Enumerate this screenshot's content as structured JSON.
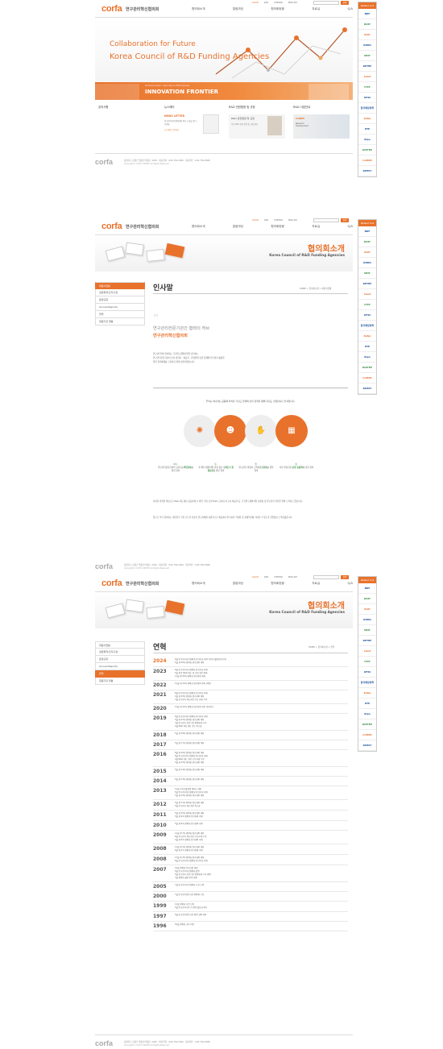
{
  "header": {
    "logo": "corfa",
    "title": "연구관리혁신협의회",
    "nav": [
      "협의회소개",
      "알림마당",
      "협의회현황",
      "자료실",
      "Q/A"
    ],
    "util": [
      "LOGIN",
      "JOIN",
      "SITEMAP",
      "ENGLISH"
    ],
    "search_btn": "검색"
  },
  "sidebar": {
    "title": "Related Link",
    "items": [
      "NRF",
      "KOIT",
      "KIAT",
      "KHIDI",
      "KEIT",
      "KETEP",
      "Ciast",
      "ITTP",
      "KFRI",
      "한국해양과학",
      "Kofpi",
      "IITP",
      "Kipo",
      "KISTEP",
      "CoMPA",
      "KIMST",
      "KISTEP"
    ]
  },
  "home": {
    "hero_en1": "Collaboration for Future",
    "hero_en2": "Korea Council of R&D Funding Agencies",
    "innovation_small": "Professionalism / Specialty & Effectiveness",
    "innovation": "INNOVATION FRONTIER",
    "cols": [
      "공지사항",
      "뉴스레터",
      "R&D 관련법령 및 규정",
      "R&D 사업안내"
    ],
    "newsletter_title": "NEWS LETTER",
    "newsletter_text": "연구관리혁신협의회의 최신 소식을 만나보세요",
    "newsletter_more": "뉴스레터 구독하기",
    "regulation_title": "R&D 관련법령 및 규정",
    "regulation_text": "각종 R&D 관련 법령 및 규정 안내",
    "corfa_title": "CORFA",
    "corfa_sub": "Research Development"
  },
  "footer": {
    "logo": "corfa",
    "address": "충청북도 음성군 맹동면 태정로 1030 · 대표전화 : 043-750-2300 · 대표팩스 : 043-750-2680",
    "copy": "Copyright (c) KOTI, KISTEP. All Rights Reserved"
  },
  "sub": {
    "section_ko": "협의회소개",
    "section_en": "Korea Council of R&D Funding Agencies",
    "lnb": [
      "회원사현황",
      "설립목적/조직구성",
      "운영규정",
      "Annual Reports",
      "연혁",
      "회원기관 현황"
    ]
  },
  "greeting": {
    "title": "인사말",
    "breadcrumb": "HOME > 협의회소개 > 회원사현황",
    "quote1": "연구관리전문기관간 협력의 허브",
    "quote2": "연구관리혁신협의회",
    "p1": "연구관리혁신협의회는 국가연구개발사업을 관리하는",
    "p2": "연구관리전문기관이 모여 경험과 · 제공과 · 운영방법 등을 함께해 연구성과 활용을",
    "p3": "위한 협력체계를 구축하기 위해 설립되었습니다.",
    "lead": "우리는 하나라는 공동체 의식을 가지고 유례와 같이 협력을 통해 지금도 경험합니다 전과합니다.",
    "items": [
      {
        "num": "하나.",
        "a": "연구관리전문기관의 교류기능",
        "b": "책임강화",
        "c": "를 위한 협의"
      },
      {
        "num": "둘.",
        "a": "국가연구개발사업 관련 정보 및",
        "b": "파트너 현재교류",
        "c": "를 위한 협의"
      },
      {
        "num": "셋.",
        "a": "연구관리 행정의 고객지향성",
        "b": "강화",
        "c": "를 위한 협의"
      },
      {
        "num": "넷.",
        "a": "기타 연관기관 ",
        "b": "운영 효율화",
        "c": "에 관한 협의"
      }
    ],
    "body1": "이러한 협력을 바탕으로 R&D 개도개선 공동과제 수 개역, 혁신 선진 R&D 교육/토서 도서 제공과 등, 국가연구개발사업 효율성 및 연구관리 혁신을 위해 노력하고 있습니다.",
    "body2": "앞으로 우리 협의회는 대한민국 국민 모두의 목표인 연구자에게 효율적으로 제공하여 연구성과 극대화 및 경제혁신에 기여할 수 있도록 끊임없이 노력하겠습니다."
  },
  "history": {
    "title": "연혁",
    "breadcrumb": "HOME > 협의회소개 > 연혁",
    "rows": [
      {
        "year": "2024",
        "lines": [
          "6월 연구관리혁신협의회 정기총회 개최 (과학기술정보통신부)",
          "5월 제 26차 협의회 정기회의 개최"
        ]
      },
      {
        "year": "2023",
        "lines": [
          "6월 연구관리혁신협의회 정기총회 개최",
          "5월 정부 R&D 제도 및 규정 개선 협의",
          "11월 제 25차 협의회 정기회의 개최"
        ]
      },
      {
        "year": "2022",
        "lines": [
          "11월 제 24차 협의회 정기회의 개최 (세종)"
        ]
      },
      {
        "year": "2021",
        "lines": [
          "6월 연구관리혁신협의회 정기총회 개최",
          "4월 제 23차 협의회 정기회의 개최",
          "3월 연구관리 제도개선 공동 과제 수행"
        ]
      },
      {
        "year": "2020",
        "lines": [
          "11월 제 22차 협의회 정기회의 개최 (온라인)"
        ]
      },
      {
        "year": "2019",
        "lines": [
          "6월 연구관리혁신협의회 정기총회 개최",
          "5월 제 21차 협의회 정기회의 개최",
          "3월 연구관리 전문기관 협력체계 구축",
          "2월 R&D 제도개선 공동 워크숍"
        ]
      },
      {
        "year": "2018",
        "lines": [
          "5월 제 19차 협의회 정기회의 개최"
        ]
      },
      {
        "year": "2017",
        "lines": [
          "5월 제 17차 협의회 정기회의 개최"
        ]
      },
      {
        "year": "2016",
        "lines": [
          "8월 제 16차 협의회 정기회의 개최",
          "6월 연구관리혁신협의회 정기총회 개최",
          "4월 R&D 제도 개선 공동과제 수행",
          "3월 제 15차 협의회 정기회의 개최"
        ]
      },
      {
        "year": "2015",
        "lines": [
          "5월 제 14차 협의회 정기회의 개최"
        ]
      },
      {
        "year": "2014",
        "lines": [
          "5월 제 13차 협의회 정기회의 개최"
        ]
      },
      {
        "year": "2013",
        "lines": [
          "11월 과학기술정책 세미나 개최",
          "5월 연구관리혁신협의회 정기총회 개최",
          "3월 제 12차 협의회 정기회의 개최"
        ]
      },
      {
        "year": "2012",
        "lines": [
          "5월 제 11차 협의회 정기회의 개최",
          "3월 연구관리 제도개선 워크숍"
        ]
      },
      {
        "year": "2011",
        "lines": [
          "5월 제 10차 협의회 정기회의 개최",
          "3월 제 9차 협의회 정기회의 개최"
        ]
      },
      {
        "year": "2010",
        "lines": [
          "5월 제 8차 협의회 정기회의 개최"
        ]
      },
      {
        "year": "2009",
        "lines": [
          "11월 제 7차 협의회 정기회의 개최",
          "6월 연구관리 제도개선 공동과제 수행",
          "4월 제 6차 협의회 정기회의 개최"
        ]
      },
      {
        "year": "2008",
        "lines": [
          "11월 제 5차 협의회 정기회의 개최",
          "6월 제 4차 협의회 정기회의 개최"
        ]
      },
      {
        "year": "2008",
        "lines": [
          "11월 제 3차 협의회 정기회의 개최",
          "6월 연구관리혁신협의회 정기총회 개최"
        ]
      },
      {
        "year": "2007",
        "lines": [
          "12월 협의회 운영규정 제정",
          "9월 연구관리혁신협의회 발족",
          "5월 연구관리 전문기관 협력체계 구축 협의",
          "3월 협의회 설립 준비 회의"
        ]
      },
      {
        "year": "2005",
        "lines": [
          "7월 연구관리혁신협의회 구성 논의"
        ]
      },
      {
        "year": "2000",
        "lines": [
          "7월 연구관리전문기관 협의체 구성"
        ]
      },
      {
        "year": "1999",
        "lines": [
          "11월 협의회 추진 논의",
          "5월 연구관리기관 간 협력 필요성 제기"
        ]
      },
      {
        "year": "1997",
        "lines": [
          "6월 연구관리전문기관 협력 회의 개최"
        ]
      },
      {
        "year": "1996",
        "lines": [
          "10월 협의회 기반 마련"
        ]
      }
    ]
  }
}
